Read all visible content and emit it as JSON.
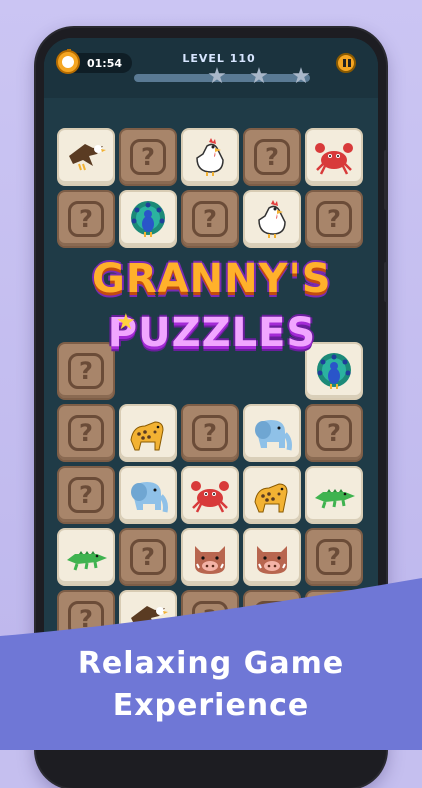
{
  "hud": {
    "timer": "01:54",
    "level": "LEVEL 110",
    "stars_total": 3
  },
  "logo": {
    "line1": "GRANNY'S",
    "line2": "PUZZLES"
  },
  "tiles": [
    {
      "row": 0,
      "col": 0,
      "kind": "eagle"
    },
    {
      "row": 0,
      "col": 1,
      "kind": "hidden"
    },
    {
      "row": 0,
      "col": 2,
      "kind": "chicken"
    },
    {
      "row": 0,
      "col": 3,
      "kind": "hidden"
    },
    {
      "row": 0,
      "col": 4,
      "kind": "crab"
    },
    {
      "row": 1,
      "col": 0,
      "kind": "hidden"
    },
    {
      "row": 1,
      "col": 1,
      "kind": "peacock"
    },
    {
      "row": 1,
      "col": 2,
      "kind": "hidden"
    },
    {
      "row": 1,
      "col": 3,
      "kind": "chicken"
    },
    {
      "row": 1,
      "col": 4,
      "kind": "hidden"
    },
    {
      "row": 2,
      "col": 0,
      "kind": "hidden"
    },
    {
      "row": 2,
      "col": 4,
      "kind": "peacock"
    },
    {
      "row": 3,
      "col": 0,
      "kind": "hidden"
    },
    {
      "row": 3,
      "col": 1,
      "kind": "leopard"
    },
    {
      "row": 3,
      "col": 2,
      "kind": "hidden"
    },
    {
      "row": 3,
      "col": 3,
      "kind": "elephant"
    },
    {
      "row": 3,
      "col": 4,
      "kind": "hidden"
    },
    {
      "row": 4,
      "col": 0,
      "kind": "hidden"
    },
    {
      "row": 4,
      "col": 1,
      "kind": "elephant"
    },
    {
      "row": 4,
      "col": 2,
      "kind": "crab"
    },
    {
      "row": 4,
      "col": 3,
      "kind": "leopard"
    },
    {
      "row": 4,
      "col": 4,
      "kind": "crocodile"
    },
    {
      "row": 5,
      "col": 0,
      "kind": "crocodile"
    },
    {
      "row": 5,
      "col": 1,
      "kind": "hidden"
    },
    {
      "row": 5,
      "col": 2,
      "kind": "boar"
    },
    {
      "row": 5,
      "col": 3,
      "kind": "boar"
    },
    {
      "row": 5,
      "col": 4,
      "kind": "hidden"
    },
    {
      "row": 6,
      "col": 0,
      "kind": "hidden"
    },
    {
      "row": 6,
      "col": 1,
      "kind": "eagle"
    },
    {
      "row": 6,
      "col": 2,
      "kind": "hidden"
    },
    {
      "row": 6,
      "col": 3,
      "kind": "hidden"
    },
    {
      "row": 6,
      "col": 4,
      "kind": "hidden"
    }
  ],
  "hidden_symbol": "?",
  "headline": {
    "line1": "Relaxing Game",
    "line2": "Experience"
  },
  "colors": {
    "background": "#c5bfef",
    "board": "#1f3b47",
    "wave": "#6f77d6",
    "tile_hidden": "#a8856a",
    "tile_face": "#f3ecdc"
  }
}
